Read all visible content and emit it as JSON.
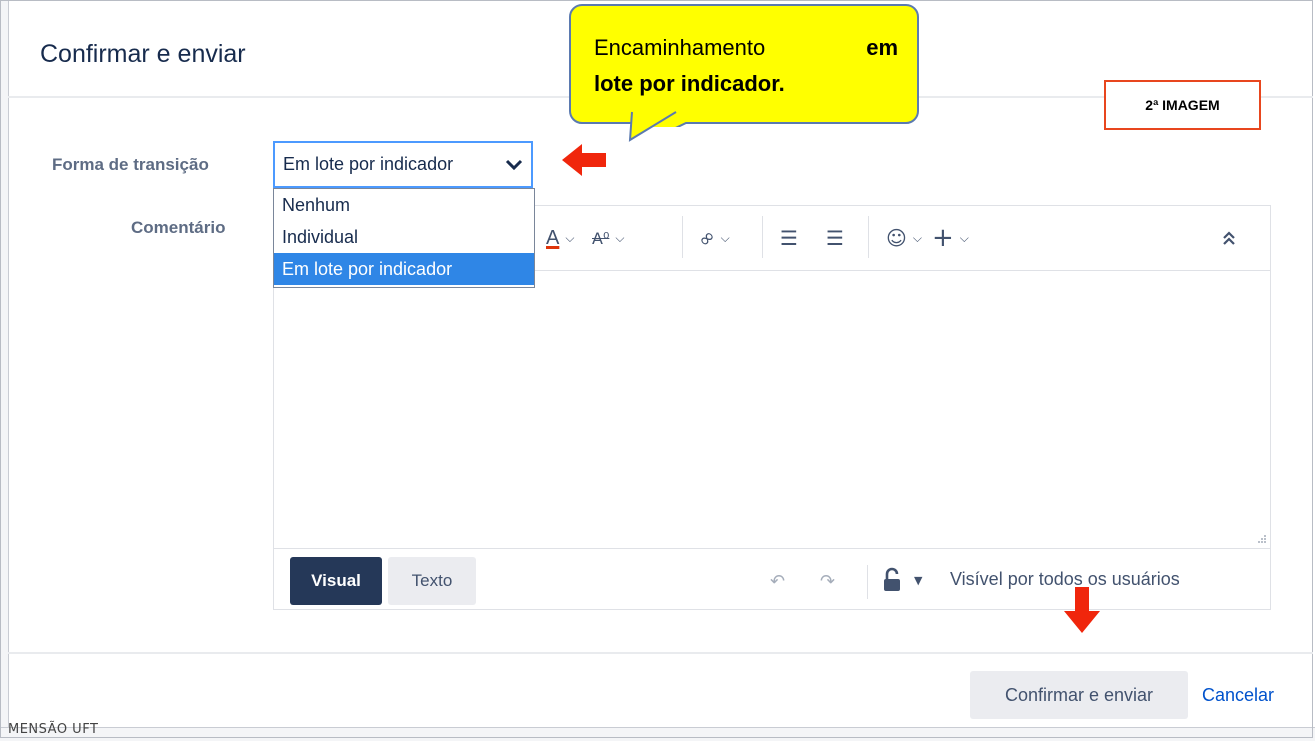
{
  "dialog": {
    "title": "Confirmar e enviar"
  },
  "form": {
    "transition_label": "Forma de transição",
    "transition_value": "Em lote por indicador",
    "transition_options": [
      "Nenhum",
      "Individual",
      "Em lote por indicador"
    ],
    "comment_label": "Comentário"
  },
  "editor": {
    "toolbar_icons": [
      "text-color-icon",
      "text-effects-icon",
      "link-icon",
      "bullet-list-icon",
      "numbered-list-icon",
      "emoji-icon",
      "plus-icon",
      "collapse-icon"
    ],
    "mode_visual": "Visual",
    "mode_text": "Texto",
    "visibility_text": "Visível por todos os usuários"
  },
  "footer": {
    "confirm_label": "Confirmar e enviar",
    "cancel_label": "Cancelar"
  },
  "annotations": {
    "callout_line1_left": "Encaminhamento",
    "callout_line1_right": "em",
    "callout_line2": "lote por indicador.",
    "badge": "2ª IMAGEM"
  },
  "background": {
    "partial_text": "MENSÃO UFT"
  },
  "colors": {
    "accent": "#2f86e6",
    "primary_button": "#253858",
    "annotation_red": "#e8461e",
    "callout_yellow": "#ffff00",
    "link": "#0052cc"
  }
}
